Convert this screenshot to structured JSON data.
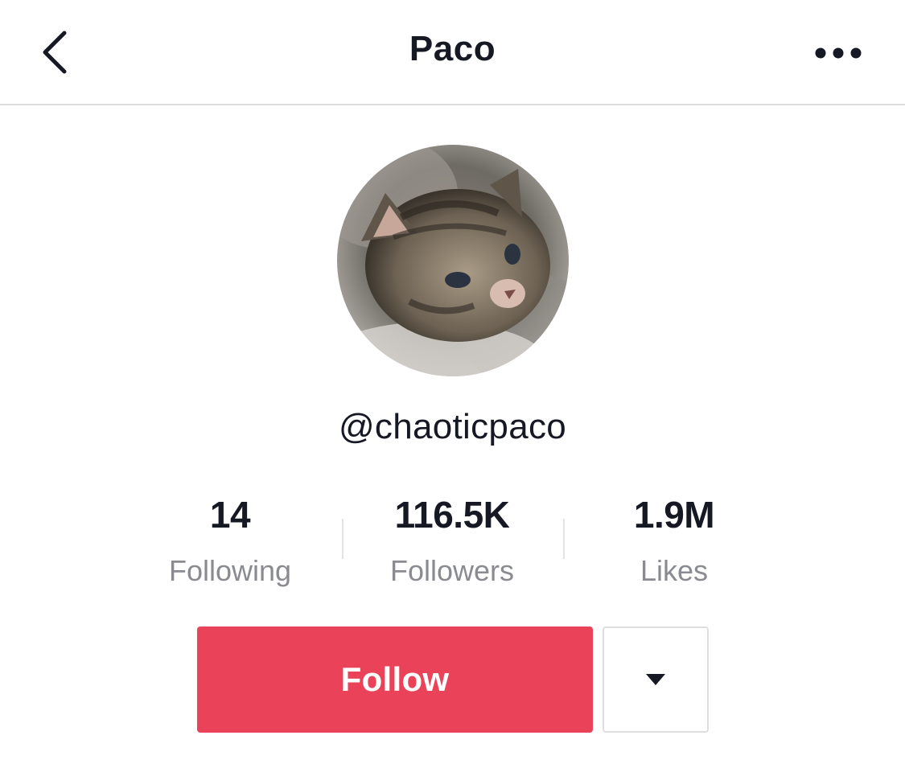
{
  "header": {
    "title": "Paco",
    "back_icon": "chevron-left-icon",
    "more_icon": "ellipsis-icon"
  },
  "profile": {
    "avatar_description": "kitten-avatar",
    "handle": "@chaoticpaco"
  },
  "stats": [
    {
      "value": "14",
      "label": "Following"
    },
    {
      "value": "116.5K",
      "label": "Followers"
    },
    {
      "value": "1.9M",
      "label": "Likes"
    }
  ],
  "actions": {
    "follow_label": "Follow",
    "dropdown_icon": "caret-down-icon"
  },
  "colors": {
    "accent": "#ea4359",
    "text_primary": "#161823",
    "text_secondary": "#8a8b91",
    "divider": "#dcdcdc"
  }
}
